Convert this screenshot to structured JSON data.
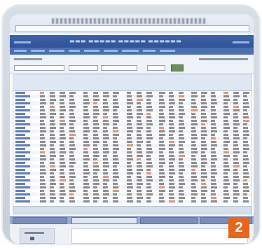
{
  "badge": {
    "number": "2"
  },
  "colors": {
    "accent": "#e8651c",
    "banner": "#2f5497",
    "frame": "#d3d9e2"
  },
  "icons": {
    "nav": "toolbar-icons"
  }
}
